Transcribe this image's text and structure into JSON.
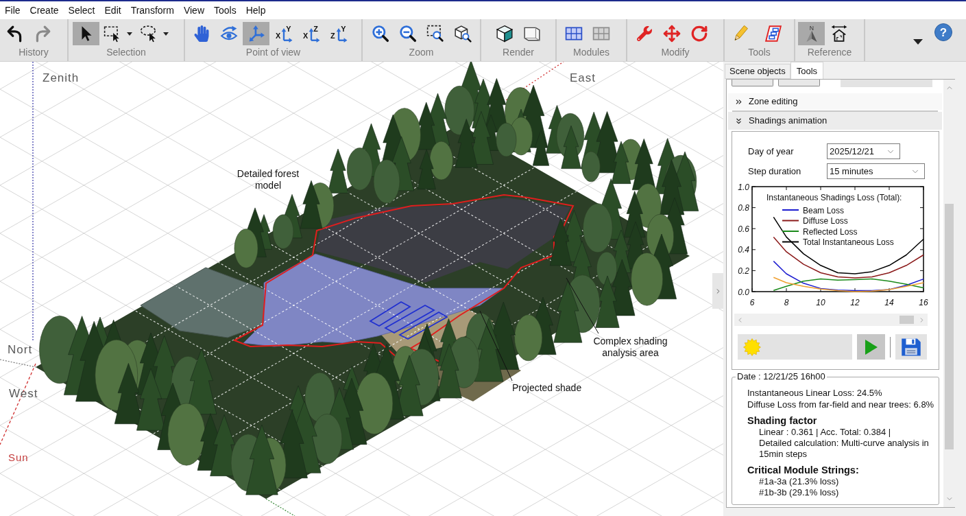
{
  "menu": [
    "File",
    "Create",
    "Select",
    "Edit",
    "Transform",
    "View",
    "Tools",
    "Help"
  ],
  "toolbar": {
    "groups": [
      {
        "label": "History",
        "tools": [
          {
            "kind": "undo",
            "pressed": false,
            "disabled": false
          },
          {
            "kind": "redo",
            "pressed": false,
            "disabled": true
          }
        ]
      },
      {
        "label": "Selection",
        "tools": [
          {
            "kind": "select-arrow",
            "pressed": true,
            "menu": false
          },
          {
            "kind": "rect-select",
            "pressed": false,
            "menu": true
          },
          {
            "kind": "lasso-select",
            "pressed": false,
            "menu": true
          }
        ]
      },
      {
        "label": "Point of view",
        "tools": [
          {
            "kind": "pan-hand",
            "pressed": false
          },
          {
            "kind": "orbit-eye",
            "pressed": false
          },
          {
            "kind": "axes-3d",
            "pressed": true
          },
          {
            "kind": "plane-axes",
            "pressed": false,
            "glyphs": [
              "X",
              "Y"
            ]
          },
          {
            "kind": "plane-axes",
            "pressed": false,
            "glyphs": [
              "X",
              "Z"
            ]
          },
          {
            "kind": "plane-axes",
            "pressed": false,
            "glyphs": [
              "Z",
              "Y"
            ]
          }
        ]
      },
      {
        "label": "Zoom",
        "tools": [
          {
            "kind": "zoom-in",
            "pressed": false
          },
          {
            "kind": "zoom-out",
            "pressed": false
          },
          {
            "kind": "zoom-window",
            "pressed": false
          },
          {
            "kind": "zoom-object",
            "pressed": false
          }
        ]
      },
      {
        "label": "Render",
        "tools": [
          {
            "kind": "shaded-cube",
            "pressed": false
          },
          {
            "kind": "wire-cube",
            "pressed": false
          }
        ]
      },
      {
        "label": "Modules",
        "tools": [
          {
            "kind": "module-grid",
            "pressed": false
          },
          {
            "kind": "module-grid-off",
            "pressed": false
          }
        ]
      },
      {
        "label": "Modify",
        "tools": [
          {
            "kind": "wrench",
            "pressed": false
          },
          {
            "kind": "move-arrows",
            "pressed": false
          },
          {
            "kind": "rotate-arrow",
            "pressed": false
          }
        ]
      },
      {
        "label": "Tools",
        "tools": [
          {
            "kind": "pencil",
            "pressed": false
          },
          {
            "kind": "stacked-boxes",
            "pressed": false
          }
        ]
      },
      {
        "label": "Reference",
        "tools": [
          {
            "kind": "north-arrow",
            "pressed": true,
            "glyphs": [
              "N"
            ]
          },
          {
            "kind": "house-dimension",
            "pressed": false
          }
        ]
      }
    ],
    "help": {
      "glyph": "?"
    }
  },
  "scene": {
    "axis_labels": [
      {
        "text": "Zenith",
        "kind": "axis"
      },
      {
        "text": "East",
        "kind": "axis"
      },
      {
        "text": "Nort",
        "kind": "axis"
      },
      {
        "text": "West",
        "kind": "axis"
      },
      {
        "text": "Sun",
        "kind": "sun"
      }
    ],
    "annotations": [
      "Detailed forest model",
      "Complex shading analysis area",
      "Projected shade"
    ]
  },
  "panel": {
    "tabs": [
      {
        "label": "Scene objects",
        "selected": false
      },
      {
        "label": "Tools",
        "selected": true
      }
    ],
    "sections": [
      {
        "title": "Zone editing",
        "expanded": false
      },
      {
        "title": "Shadings animation",
        "expanded": true
      }
    ],
    "animation": {
      "fields": [
        {
          "label": "Day of year",
          "value": "2025/12/21"
        },
        {
          "label": "Step duration",
          "value": "15 minutes"
        }
      ],
      "chart_data": {
        "type": "line",
        "title": "Instantaneous Shadings Loss (Total):",
        "legend": "upper center",
        "x": [
          7.25,
          8,
          9,
          10,
          11,
          12,
          13,
          14,
          15,
          16
        ],
        "series": [
          {
            "name": "Beam Loss",
            "color": "#1c1cd0",
            "values": [
              0.29,
              0.17,
              0.08,
              0.03,
              0.015,
              0.01,
              0.01,
              0.02,
              0.06,
              0.12
            ]
          },
          {
            "name": "Diffuse Loss",
            "color": "#8b1a1a",
            "values": [
              0.52,
              0.38,
              0.26,
              0.18,
              0.14,
              0.13,
              0.14,
              0.18,
              0.25,
              0.35
            ]
          },
          {
            "name": "Reflected Loss",
            "color": "#1a8a1a",
            "values": [
              0.012,
              0.05,
              0.1,
              0.12,
              0.11,
              0.115,
              0.12,
              0.1,
              0.07,
              0.035
            ]
          },
          {
            "name": "Total Instantaneous Loss",
            "color": "#000000",
            "values": [
              0.71,
              0.52,
              0.36,
              0.25,
              0.18,
              0.17,
              0.19,
              0.25,
              0.35,
              0.5
            ]
          },
          {
            "color": "#f0a030",
            "values": [
              0.135,
              0.085,
              0.05,
              0.025,
              0.01,
              0.0,
              0.005,
              0.02,
              0.05,
              0.085
            ]
          }
        ],
        "xlim": [
          6,
          16
        ],
        "ylim": [
          0,
          1
        ],
        "xticks": [
          6,
          8,
          10,
          12,
          14,
          16
        ],
        "yticks": [
          {
            "value": 0,
            "label": "0.0"
          },
          {
            "value": 0.2,
            "label": "0.2"
          },
          {
            "value": 0.4,
            "label": "0.4"
          },
          {
            "value": 0.6,
            "label": "0.6"
          },
          {
            "value": 0.8,
            "label": "0.8"
          },
          {
            "value": 1,
            "label": "1.0"
          }
        ]
      },
      "buttons": [
        {
          "kind": "sun"
        },
        {
          "kind": "play"
        },
        {
          "kind": "save"
        }
      ]
    },
    "results": {
      "title": "Date : 12/21/25 16h00",
      "lines": [
        "Instantaneous Linear Loss: 24.5%",
        "Diffuse Loss from far-field and near trees: 6.8%"
      ],
      "groups": [
        {
          "heading": "Shading factor",
          "lines": [
            "Linear : 0.361 | Acc. Total: 0.384 |",
            "Detailed calculation: Multi-curve analysis in",
            "15min steps"
          ]
        },
        {
          "heading": "Critical Module Strings:",
          "lines": [
            "#1a-3a (21.3% loss)",
            "#1b-3b (29.1% loss)"
          ]
        }
      ]
    }
  }
}
